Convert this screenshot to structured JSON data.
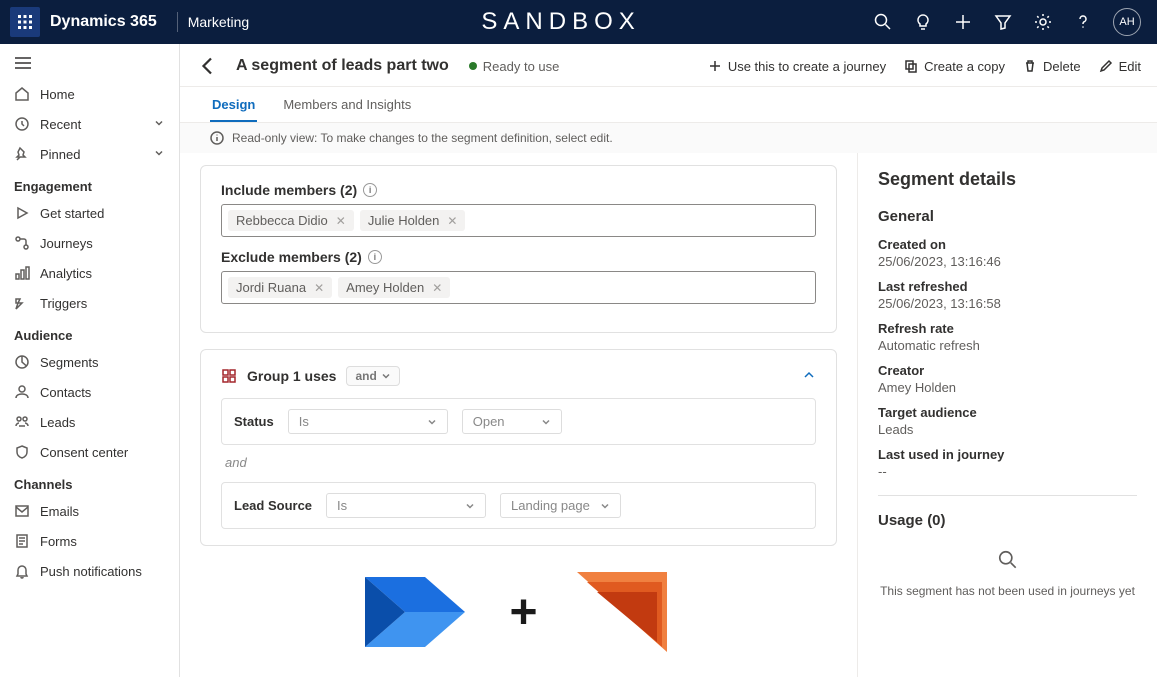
{
  "appbar": {
    "brand": "Dynamics 365",
    "area": "Marketing",
    "center": "SANDBOX",
    "avatar": "AH"
  },
  "sidebar": {
    "top": [
      {
        "label": "Home"
      },
      {
        "label": "Recent"
      },
      {
        "label": "Pinned"
      }
    ],
    "groups": [
      {
        "label": "Engagement",
        "items": [
          "Get started",
          "Journeys",
          "Analytics",
          "Triggers"
        ]
      },
      {
        "label": "Audience",
        "items": [
          "Segments",
          "Contacts",
          "Leads",
          "Consent center"
        ]
      },
      {
        "label": "Channels",
        "items": [
          "Emails",
          "Forms",
          "Push notifications"
        ]
      }
    ]
  },
  "cmdbar": {
    "title": "A segment of leads part two",
    "status": "Ready to use",
    "actions": {
      "use": "Use this to create a journey",
      "copy": "Create a copy",
      "delete": "Delete",
      "edit": "Edit"
    }
  },
  "tabs": [
    "Design",
    "Members and Insights"
  ],
  "infobar": "Read-only view: To make changes to the segment definition, select edit.",
  "designer": {
    "include_label": "Include members (2)",
    "exclude_label": "Exclude members (2)",
    "include": [
      "Rebbecca Didio",
      "Julie Holden"
    ],
    "exclude": [
      "Jordi Ruana",
      "Amey Holden"
    ],
    "group_label": "Group 1 uses",
    "and_pill": "and",
    "conds": [
      {
        "field": "Status",
        "op": "Is",
        "val": "Open"
      },
      {
        "field": "Lead Source",
        "op": "Is",
        "val": "Landing page"
      }
    ],
    "and_text": "and"
  },
  "details": {
    "title": "Segment details",
    "general_heading": "General",
    "fields": [
      {
        "label": "Created on",
        "value": "25/06/2023, 13:16:46"
      },
      {
        "label": "Last refreshed",
        "value": "25/06/2023, 13:16:58"
      },
      {
        "label": "Refresh rate",
        "value": "Automatic refresh"
      },
      {
        "label": "Creator",
        "value": "Amey Holden"
      },
      {
        "label": "Target audience",
        "value": "Leads"
      },
      {
        "label": "Last used in journey",
        "value": "--"
      }
    ],
    "usage_heading": "Usage (0)",
    "usage_empty": "This segment has not been used in journeys yet"
  }
}
